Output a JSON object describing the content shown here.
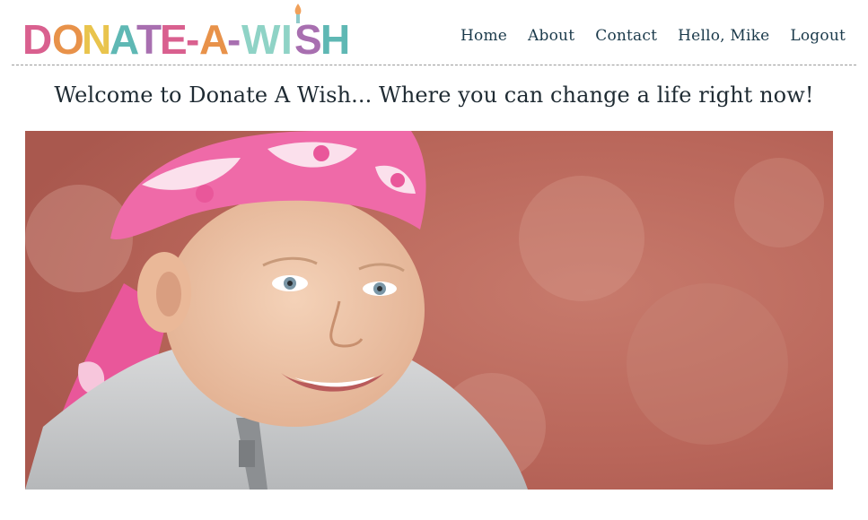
{
  "header": {
    "logo_text": "DONATE-A-WISH",
    "nav": [
      {
        "label": "Home"
      },
      {
        "label": "About"
      },
      {
        "label": "Contact"
      },
      {
        "label": "Hello, Mike"
      },
      {
        "label": "Logout"
      }
    ]
  },
  "main": {
    "heading": "Welcome to Donate A Wish... Where you can change a life right now!",
    "hero_image": "smiling-child-in-pink-bandana-photo"
  },
  "colors": {
    "nav_text": "#1b3a4b",
    "heading_text": "#1f2b33",
    "logo_pink": "#d9608f",
    "logo_orange": "#e8924a",
    "logo_yellow": "#e9c44d",
    "logo_teal": "#5fb8b4",
    "logo_purple": "#a86fb0"
  }
}
